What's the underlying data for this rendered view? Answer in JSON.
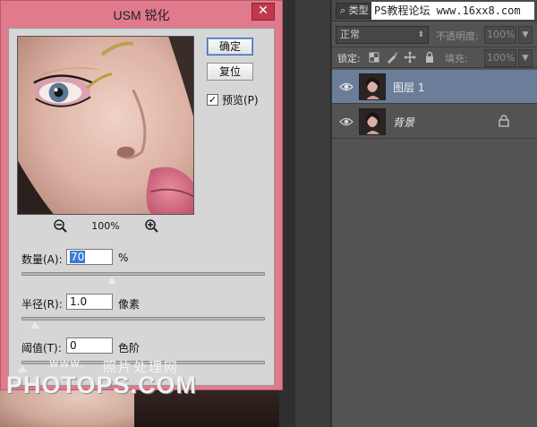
{
  "dialog": {
    "title": "USM 锐化",
    "close_label": "✕",
    "zoom_level": "100%",
    "ok_label": "确定",
    "reset_label": "复位",
    "preview_label": "预览(P)",
    "preview_checked": true,
    "amount": {
      "label": "数量(A):",
      "value": "70",
      "unit": "%",
      "slider_fraction": 0.37
    },
    "radius": {
      "label": "半径(R):",
      "value": "1.0",
      "unit": "像素",
      "slider_fraction": 0.05
    },
    "threshold": {
      "label": "阈值(T):",
      "value": "0",
      "unit": "色阶",
      "slider_fraction": 0.0
    }
  },
  "watermark": {
    "site": "www.",
    "cn": "照片处理网",
    "brand": "PHOTOPS.COM"
  },
  "layers_panel": {
    "filter_label": "⌕ 类型",
    "site_banner": "PS教程论坛 www.16xx8.com",
    "blend_mode": "正常",
    "opacity_label": "不透明度:",
    "opacity_value": "100%",
    "lock_label": "锁定:",
    "fill_label": "填充:",
    "fill_value": "100%",
    "layers": [
      {
        "name": "图层 1",
        "selected": true
      },
      {
        "name": "背景",
        "locked": true
      }
    ]
  },
  "colors": {
    "dialog_frame": "#e07a8c",
    "close_button": "#c0394b",
    "selected_layer": "#6a7e9a",
    "panel_bg": "#535353"
  }
}
